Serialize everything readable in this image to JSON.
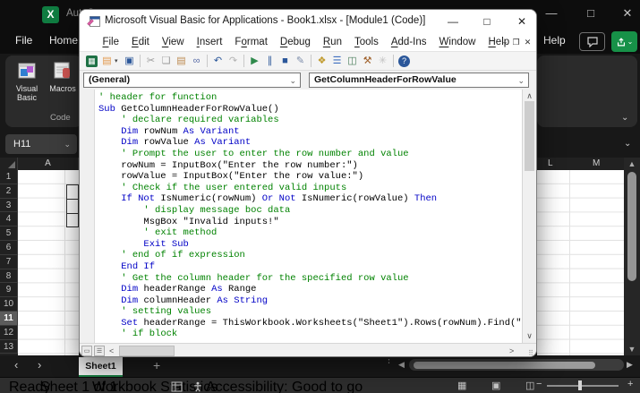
{
  "excel": {
    "titlebar": {
      "autosave": "AutoSave"
    },
    "window_controls": {
      "minimize": "—",
      "maximize": "□",
      "close": "✕"
    },
    "ribbon_tabs": {
      "file": "File",
      "home": "Home",
      "help": "Help"
    },
    "ribbon_group": {
      "visual_basic": "Visual Basic",
      "macros": "Macros",
      "group_label": "Code"
    },
    "name_box": "H11",
    "grid": {
      "columns": {
        "a": "A",
        "l": "L",
        "m": "M"
      },
      "row_numbers": [
        "1",
        "2",
        "3",
        "4",
        "5",
        "6",
        "7",
        "8",
        "9",
        "10",
        "11",
        "12",
        "13"
      ],
      "selected_row": "11"
    },
    "sheet_bar": {
      "tab": "Sheet1",
      "add": "+"
    },
    "status_bar": {
      "ready": "Ready",
      "sheet_count": "Sheet 1 of 1",
      "workbook_statistics": "Workbook Statistics",
      "accessibility": "Accessibility: Good to go"
    },
    "zoom": {
      "minus": "−",
      "plus": "+"
    }
  },
  "vba": {
    "title": "Microsoft Visual Basic for Applications - Book1.xlsx - [Module1 (Code)]",
    "window_controls": {
      "minimize": "—",
      "maximize": "□",
      "close": "✕"
    },
    "mdi_controls": {
      "minimize": "–",
      "restore": "❐",
      "close": "✕"
    },
    "menus": [
      {
        "label": "File",
        "accel": 0
      },
      {
        "label": "Edit",
        "accel": 0
      },
      {
        "label": "View",
        "accel": 0
      },
      {
        "label": "Insert",
        "accel": 0
      },
      {
        "label": "Format",
        "accel": 1
      },
      {
        "label": "Debug",
        "accel": 0
      },
      {
        "label": "Run",
        "accel": 0
      },
      {
        "label": "Tools",
        "accel": 0
      },
      {
        "label": "Add-Ins",
        "accel": 0
      },
      {
        "label": "Window",
        "accel": 0
      },
      {
        "label": "Help",
        "accel": 0
      }
    ],
    "toolbar": [
      {
        "name": "view-excel-icon",
        "glyph": "▦",
        "color": "#ffffff",
        "bg": "#1e7145"
      },
      {
        "name": "insert-userform-icon",
        "glyph": "▤",
        "color": "#e2974a",
        "caret": true
      },
      {
        "name": "save-icon",
        "glyph": "▣",
        "color": "#2b579a"
      },
      {
        "sep": true
      },
      {
        "name": "cut-icon",
        "glyph": "✂",
        "color": "#9a9a9a"
      },
      {
        "name": "copy-icon",
        "glyph": "❏",
        "color": "#9a9a9a"
      },
      {
        "name": "paste-icon",
        "glyph": "▤",
        "color": "#bc8a50"
      },
      {
        "name": "find-icon",
        "glyph": "∞",
        "color": "#5b6ea8"
      },
      {
        "sep": true
      },
      {
        "name": "undo-icon",
        "glyph": "↶",
        "color": "#2b579a"
      },
      {
        "name": "redo-icon",
        "glyph": "↷",
        "color": "#b3b3b3"
      },
      {
        "sep": true
      },
      {
        "name": "run-icon",
        "glyph": "▶",
        "color": "#2f8a4c"
      },
      {
        "name": "break-icon",
        "glyph": "∥",
        "color": "#2b579a"
      },
      {
        "name": "reset-icon",
        "glyph": "■",
        "color": "#2b579a"
      },
      {
        "name": "design-mode-icon",
        "glyph": "✎",
        "color": "#7c8cab"
      },
      {
        "sep": true
      },
      {
        "name": "project-explorer-icon",
        "glyph": "❖",
        "color": "#c09a2c"
      },
      {
        "name": "properties-window-icon",
        "glyph": "☰",
        "color": "#3f6fbf"
      },
      {
        "name": "object-browser-icon",
        "glyph": "◫",
        "color": "#4a7d5a"
      },
      {
        "name": "toolbox-icon",
        "glyph": "⚒",
        "color": "#a0622d"
      },
      {
        "name": "intellisense-icon",
        "glyph": "✳",
        "color": "#c2c2c2"
      },
      {
        "sep": true
      },
      {
        "name": "help-icon",
        "glyph": "?",
        "color": "#ffffff",
        "bg": "#2b579a",
        "round": true
      }
    ],
    "combos": {
      "object": "(General)",
      "procedure": "GetColumnHeaderForRowValue"
    },
    "colors": {
      "keyword": "#0000C6",
      "comment": "#008200",
      "text": "#000000"
    },
    "code": {
      "lines": [
        {
          "segs": [
            {
              "t": "' header for function",
              "c": "com"
            }
          ]
        },
        {
          "segs": [
            {
              "t": "Sub ",
              "c": "kw"
            },
            {
              "t": "GetColumnHeaderForRowValue()",
              "c": "txt"
            }
          ]
        },
        {
          "segs": [
            {
              "t": "    ",
              "c": "txt"
            },
            {
              "t": "' declare required variables",
              "c": "com"
            }
          ]
        },
        {
          "segs": [
            {
              "t": "    ",
              "c": "txt"
            },
            {
              "t": "Dim ",
              "c": "kw"
            },
            {
              "t": "rowNum ",
              "c": "txt"
            },
            {
              "t": "As Variant",
              "c": "kw"
            }
          ]
        },
        {
          "segs": [
            {
              "t": "    ",
              "c": "txt"
            },
            {
              "t": "Dim ",
              "c": "kw"
            },
            {
              "t": "rowValue ",
              "c": "txt"
            },
            {
              "t": "As Variant",
              "c": "kw"
            }
          ]
        },
        {
          "segs": [
            {
              "t": "    ",
              "c": "txt"
            },
            {
              "t": "' Prompt the user to enter the row number and value",
              "c": "com"
            }
          ]
        },
        {
          "segs": [
            {
              "t": "    rowNum = InputBox(\"Enter the row number:\")",
              "c": "txt"
            }
          ]
        },
        {
          "segs": [
            {
              "t": "    rowValue = InputBox(\"Enter the row value:\")",
              "c": "txt"
            }
          ]
        },
        {
          "segs": [
            {
              "t": "    ",
              "c": "txt"
            },
            {
              "t": "' Check if the user entered valid inputs",
              "c": "com"
            }
          ]
        },
        {
          "segs": [
            {
              "t": "    ",
              "c": "txt"
            },
            {
              "t": "If Not ",
              "c": "kw"
            },
            {
              "t": "IsNumeric(rowNum) ",
              "c": "txt"
            },
            {
              "t": "Or Not ",
              "c": "kw"
            },
            {
              "t": "IsNumeric(rowValue) ",
              "c": "txt"
            },
            {
              "t": "Then",
              "c": "kw"
            }
          ]
        },
        {
          "segs": [
            {
              "t": "        ",
              "c": "txt"
            },
            {
              "t": "' display message boc data",
              "c": "com"
            }
          ]
        },
        {
          "segs": [
            {
              "t": "        MsgBox \"Invalid inputs!\"",
              "c": "txt"
            }
          ]
        },
        {
          "segs": [
            {
              "t": "        ",
              "c": "txt"
            },
            {
              "t": "' exit method",
              "c": "com"
            }
          ]
        },
        {
          "segs": [
            {
              "t": "        ",
              "c": "txt"
            },
            {
              "t": "Exit Sub",
              "c": "kw"
            }
          ]
        },
        {
          "segs": [
            {
              "t": "    ",
              "c": "txt"
            },
            {
              "t": "' end of if expression",
              "c": "com"
            }
          ]
        },
        {
          "segs": [
            {
              "t": "    ",
              "c": "txt"
            },
            {
              "t": "End If",
              "c": "kw"
            }
          ]
        },
        {
          "segs": [
            {
              "t": "    ",
              "c": "txt"
            },
            {
              "t": "' Get the column header for the specified row value",
              "c": "com"
            }
          ]
        },
        {
          "segs": [
            {
              "t": "    ",
              "c": "txt"
            },
            {
              "t": "Dim ",
              "c": "kw"
            },
            {
              "t": "headerRange ",
              "c": "txt"
            },
            {
              "t": "As ",
              "c": "kw"
            },
            {
              "t": "Range",
              "c": "txt"
            }
          ]
        },
        {
          "segs": [
            {
              "t": "    ",
              "c": "txt"
            },
            {
              "t": "Dim ",
              "c": "kw"
            },
            {
              "t": "columnHeader ",
              "c": "txt"
            },
            {
              "t": "As String",
              "c": "kw"
            }
          ]
        },
        {
          "segs": [
            {
              "t": "    ",
              "c": "txt"
            },
            {
              "t": "' setting values",
              "c": "com"
            }
          ]
        },
        {
          "segs": [
            {
              "t": "    ",
              "c": "txt"
            },
            {
              "t": "Set ",
              "c": "kw"
            },
            {
              "t": "headerRange = ThisWorkbook.Worksheets(\"Sheet1\").Rows(rowNum).Find(\"",
              "c": "txt"
            }
          ]
        },
        {
          "segs": [
            {
              "t": "    ",
              "c": "txt"
            },
            {
              "t": "' if block",
              "c": "com"
            }
          ]
        }
      ]
    }
  }
}
